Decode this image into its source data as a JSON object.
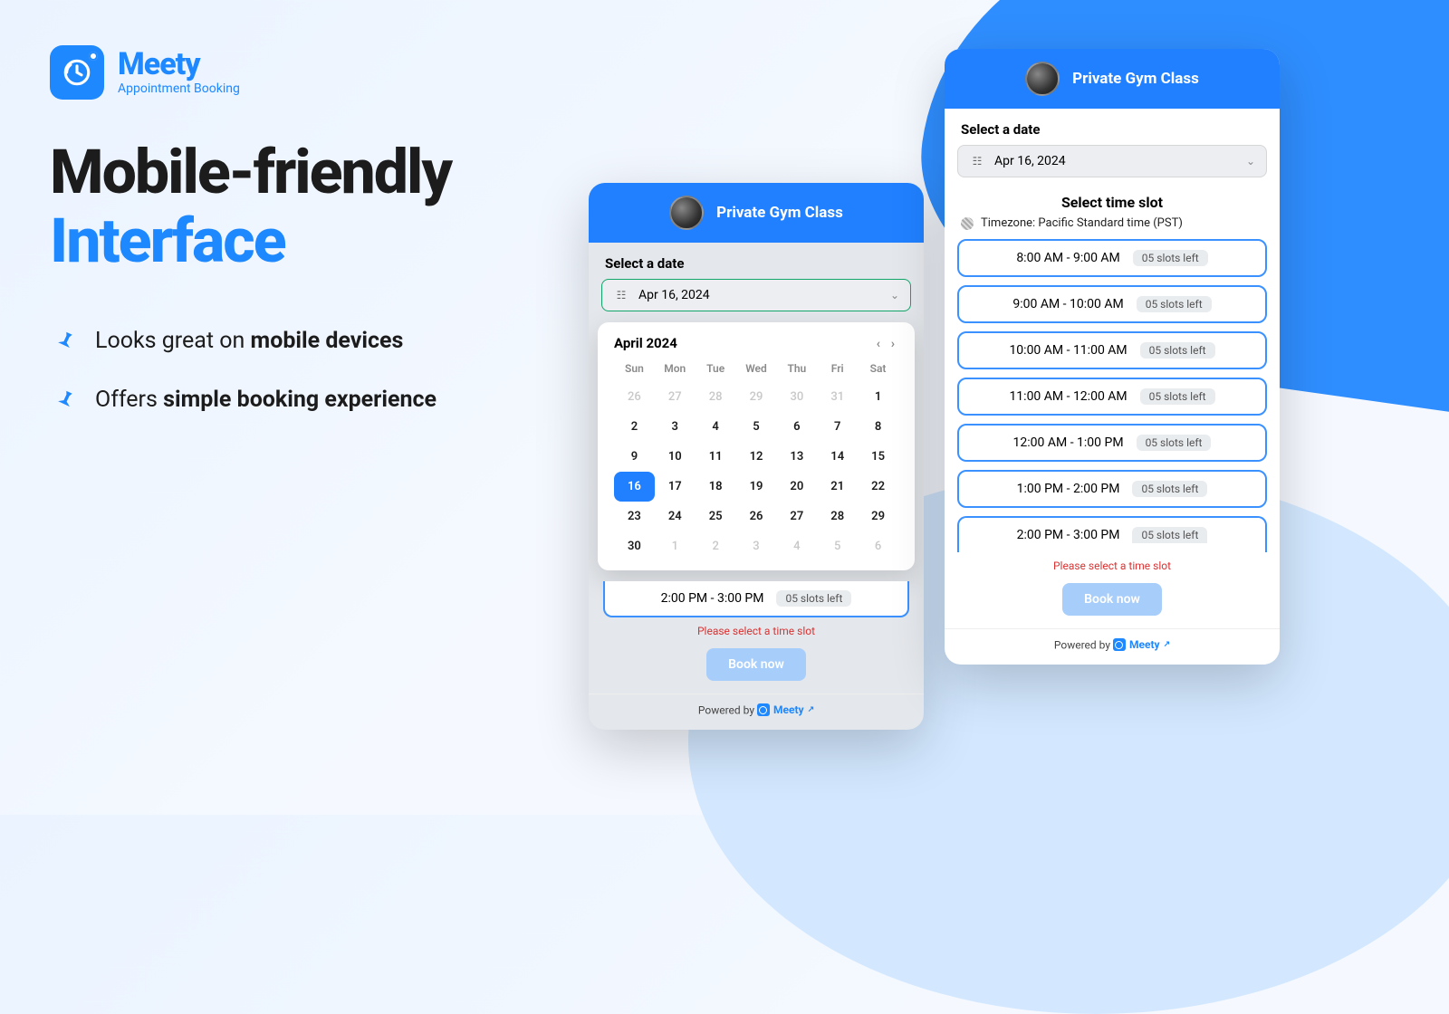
{
  "brand": {
    "name": "Meety",
    "tagline": "Appointment Booking"
  },
  "hero": {
    "line1": "Mobile-friendly",
    "line2": "Interface"
  },
  "bullets": {
    "b1_pre": "Looks great on ",
    "b1_bold": "mobile devices",
    "b2_pre": "Offers ",
    "b2_bold": "simple booking experience"
  },
  "phone_common": {
    "class_title": "Private Gym Class",
    "select_date_label": "Select a date",
    "date_value": "Apr 16, 2024",
    "powered_pre": "Powered by ",
    "powered_brand": "Meety",
    "warn": "Please select a time slot",
    "book_label": "Book now"
  },
  "calendar": {
    "month_label": "April 2024",
    "dow": [
      "Sun",
      "Mon",
      "Tue",
      "Wed",
      "Thu",
      "Fri",
      "Sat"
    ],
    "cells": [
      {
        "d": "26",
        "mute": true
      },
      {
        "d": "27",
        "mute": true
      },
      {
        "d": "28",
        "mute": true
      },
      {
        "d": "29",
        "mute": true
      },
      {
        "d": "30",
        "mute": true
      },
      {
        "d": "31",
        "mute": true
      },
      {
        "d": "1"
      },
      {
        "d": "2"
      },
      {
        "d": "3"
      },
      {
        "d": "4"
      },
      {
        "d": "5"
      },
      {
        "d": "6"
      },
      {
        "d": "7"
      },
      {
        "d": "8"
      },
      {
        "d": "9"
      },
      {
        "d": "10"
      },
      {
        "d": "11"
      },
      {
        "d": "12"
      },
      {
        "d": "13"
      },
      {
        "d": "14"
      },
      {
        "d": "15"
      },
      {
        "d": "16",
        "sel": true
      },
      {
        "d": "17"
      },
      {
        "d": "18"
      },
      {
        "d": "19"
      },
      {
        "d": "20"
      },
      {
        "d": "21"
      },
      {
        "d": "22"
      },
      {
        "d": "23"
      },
      {
        "d": "24"
      },
      {
        "d": "25"
      },
      {
        "d": "26"
      },
      {
        "d": "27"
      },
      {
        "d": "28"
      },
      {
        "d": "29"
      },
      {
        "d": "30"
      },
      {
        "d": "1",
        "mute": true
      },
      {
        "d": "2",
        "mute": true
      },
      {
        "d": "3",
        "mute": true
      },
      {
        "d": "4",
        "mute": true
      },
      {
        "d": "5",
        "mute": true
      },
      {
        "d": "6",
        "mute": true
      }
    ],
    "strip_slot": {
      "range": "2:00 PM - 3:00 PM",
      "left": "05 slots left"
    }
  },
  "timeslots": {
    "heading": "Select time slot",
    "timezone": "Timezone: Pacific Standard time (PST)",
    "list": [
      {
        "range": "8:00 AM - 9:00 AM",
        "left": "05 slots left"
      },
      {
        "range": "9:00 AM - 10:00 AM",
        "left": "05 slots left"
      },
      {
        "range": "10:00 AM - 11:00 AM",
        "left": "05 slots left"
      },
      {
        "range": "11:00 AM - 12:00 AM",
        "left": "05 slots left"
      },
      {
        "range": "12:00 AM - 1:00 PM",
        "left": "05 slots left"
      },
      {
        "range": "1:00 PM - 2:00 PM",
        "left": "05 slots left"
      },
      {
        "range": "2:00 PM - 3:00 PM",
        "left": "05 slots left"
      }
    ]
  }
}
